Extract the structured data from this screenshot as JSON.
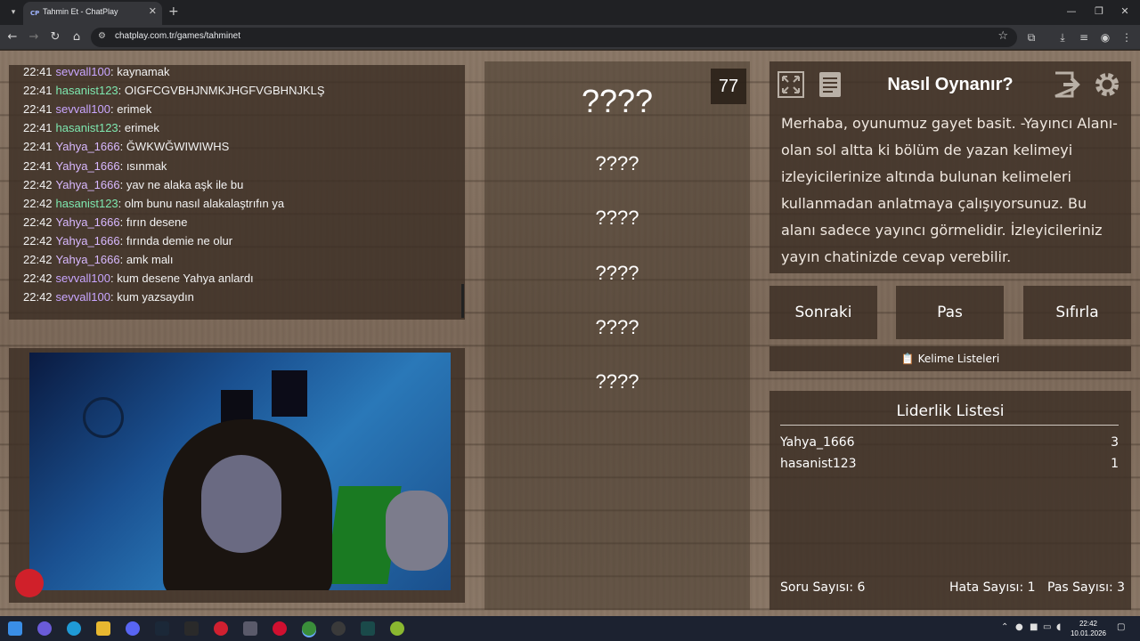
{
  "browser": {
    "tab_title": "Tahmin Et - ChatPlay",
    "tab_favicon": "CP",
    "url": "chatplay.com.tr/games/tahminet"
  },
  "chat": {
    "messages": [
      {
        "time": "22:41",
        "user": "sevvall100",
        "text": ": kaynamak",
        "color": "#c9a6ff"
      },
      {
        "time": "22:41",
        "user": "hasanist123",
        "text": ": OIGFCGVBHJNMKJHGFVGBHNJKLŞ",
        "color": "#7ee8b0"
      },
      {
        "time": "22:41",
        "user": "sevvall100",
        "text": ": erimek",
        "color": "#c9a6ff"
      },
      {
        "time": "22:41",
        "user": "hasanist123",
        "text": ": erimek",
        "color": "#7ee8b0"
      },
      {
        "time": "22:41",
        "user": "Yahya_1666",
        "text": ": ĞWKWĞWIWIWHS",
        "color": "#d8b8ff"
      },
      {
        "time": "22:41",
        "user": "Yahya_1666",
        "text": ": ısınmak",
        "color": "#d8b8ff"
      },
      {
        "time": "22:42",
        "user": "Yahya_1666",
        "text": ": yav ne alaka aşk ile bu",
        "color": "#d8b8ff"
      },
      {
        "time": "22:42",
        "user": "hasanist123",
        "text": ": olm bunu nasıl alakalaştrıfın ya",
        "color": "#7ee8b0"
      },
      {
        "time": "22:42",
        "user": "Yahya_1666",
        "text": ": fırın desene",
        "color": "#d8b8ff"
      },
      {
        "time": "22:42",
        "user": "Yahya_1666",
        "text": ": fırında demie ne olur",
        "color": "#d8b8ff"
      },
      {
        "time": "22:42",
        "user": "Yahya_1666",
        "text": ": amk malı",
        "color": "#d8b8ff"
      },
      {
        "time": "22:42",
        "user": "sevvall100",
        "text": ": kum desene Yahya anlardı",
        "color": "#c9a6ff"
      },
      {
        "time": "22:42",
        "user": "sevvall100",
        "text": ": kum yazsaydın",
        "color": "#c9a6ff"
      }
    ]
  },
  "game": {
    "timer": "77",
    "main_word": "????",
    "forbidden_words": [
      "????",
      "????",
      "????",
      "????",
      "????"
    ]
  },
  "howto": {
    "title": "Nasıl Oynanır?",
    "text": "Merhaba, oyunumuz gayet basit. -Yayıncı Alanı-olan sol altta ki bölüm de yazan kelimeyi izleyicilerinize altında bulunan kelimeleri kullanmadan anlatmaya çalışıyorsunuz. Bu alanı sadece yayıncı görmelidir. İzleyicileriniz yayın chatinizde cevap verebilir."
  },
  "actions": {
    "next": "Sonraki",
    "pass": "Pas",
    "reset": "Sıfırla",
    "lists_icon": "📋",
    "lists": "Kelime Listeleri"
  },
  "leaderboard": {
    "title": "Liderlik Listesi",
    "rows": [
      {
        "name": "Yahya_1666",
        "score": "3"
      },
      {
        "name": "hasanist123",
        "score": "1"
      }
    ],
    "questions": "Soru Sayısı: 6",
    "errors": "Hata Sayısı: 1",
    "passes": "Pas Sayısı: 3"
  },
  "clock": {
    "time": "22:42",
    "date": "10.01.2026"
  },
  "icons": {
    "fullscreen": "fullscreen-icon",
    "notes": "notes-icon",
    "logout": "logout-icon",
    "settings": "gear-icon"
  }
}
